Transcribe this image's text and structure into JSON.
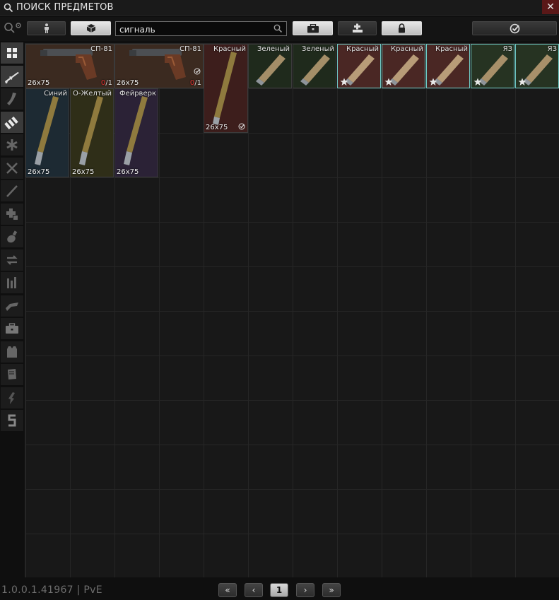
{
  "window": {
    "title": "ПОИСК ПРЕДМЕТОВ",
    "close_label": "✕"
  },
  "search": {
    "value": "сигналь"
  },
  "footer": {
    "version": "1.0.0.1.41967 | PvE"
  },
  "pagination": {
    "first": "«",
    "prev": "‹",
    "current": "1",
    "next": "›",
    "last": "»"
  },
  "colors": {
    "brown": "#3b2a20",
    "red": "#3d1e1c",
    "green": "#1f2a1c",
    "blue": "#1d2a33",
    "yellow": "#2f2e18",
    "purple": "#2b2236",
    "highlight": "#6fc9c4"
  },
  "items": [
    {
      "name": "СП-81",
      "caliber": "26x75",
      "count_zero": "0",
      "count_rest": "/1",
      "bg": "brown"
    },
    {
      "name": "СП-81",
      "caliber": "26x75",
      "count_zero": "0",
      "count_rest": "/1",
      "bg": "brown",
      "checked": true
    },
    {
      "name": "Красный",
      "caliber": "26x75",
      "bg": "red",
      "checked": true
    },
    {
      "name": "Зеленый",
      "bg": "green"
    },
    {
      "name": "Зеленый",
      "bg": "green"
    },
    {
      "name": "Красный",
      "bg": "red",
      "starred": true
    },
    {
      "name": "Красный",
      "bg": "red",
      "starred": true
    },
    {
      "name": "Красный",
      "bg": "red",
      "starred": true
    },
    {
      "name": "ЯЗ",
      "bg": "green",
      "starred": true
    },
    {
      "name": "ЯЗ",
      "bg": "green",
      "starred": true
    },
    {
      "name": "Синий",
      "caliber": "26x75",
      "bg": "blue"
    },
    {
      "name": "О-Желтый",
      "caliber": "26x75",
      "bg": "yellow"
    },
    {
      "name": "Фейрверк",
      "caliber": "26x75",
      "bg": "purple"
    }
  ]
}
